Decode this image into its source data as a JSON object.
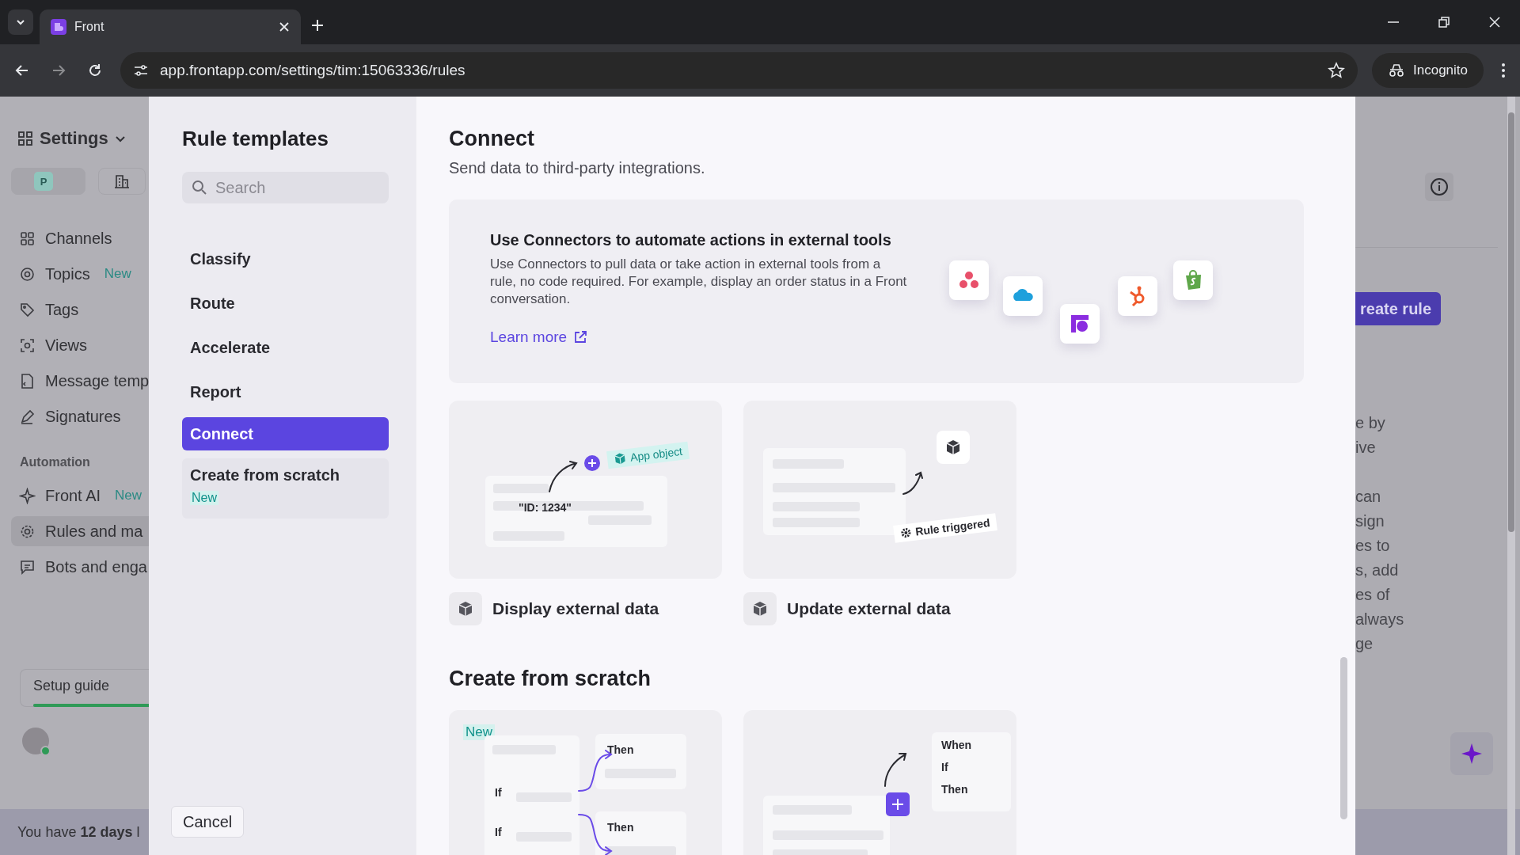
{
  "browser": {
    "tabs": [
      {
        "title": "Front",
        "selected": true
      }
    ],
    "url": "app.frontapp.com/settings/tim:15063336/rules",
    "profile": "Incognito"
  },
  "sidebar": {
    "title": "Settings",
    "scopes": [
      {
        "badge": "P",
        "selected": true
      },
      {
        "selected": false
      }
    ],
    "items": [
      {
        "label": "Channels",
        "selected": false
      },
      {
        "label": "Topics",
        "badge": "New",
        "selected": false
      },
      {
        "label": "Tags",
        "selected": false
      },
      {
        "label": "Views",
        "selected": false
      },
      {
        "label": "Message temp",
        "selected": false
      },
      {
        "label": "Signatures",
        "selected": false
      }
    ],
    "automation": {
      "heading": "Automation",
      "items": [
        {
          "label": "Front AI",
          "badge": "New",
          "selected": false
        },
        {
          "label": "Rules and ma",
          "selected": true
        },
        {
          "label": "Bots and enga",
          "selected": false
        }
      ]
    },
    "setup_guide": {
      "label": "Setup guide",
      "level": 0.8
    },
    "trial_banner": "You have **12 days** l"
  },
  "backdrop": {
    "create_button": "reate rule",
    "paragraphs": [
      [
        "e by",
        "ive"
      ],
      [
        "can",
        "sign",
        "es to",
        "s, add",
        "es of",
        "always",
        "ge"
      ]
    ]
  },
  "modal": {
    "title": "Rule templates",
    "search_placeholder": "Search",
    "categories": [
      {
        "label": "Classify",
        "selected": false
      },
      {
        "label": "Route",
        "selected": false
      },
      {
        "label": "Accelerate",
        "selected": false
      },
      {
        "label": "Report",
        "selected": false
      },
      {
        "label": "Connect",
        "selected": true
      },
      {
        "label": "Create from scratch",
        "badge": "New",
        "selected": false
      }
    ],
    "cancel": "Cancel",
    "section": {
      "title": "Connect",
      "subtitle": "Send data to third-party integrations.",
      "banner": {
        "title": "Use Connectors to automate actions in external tools",
        "body": "Use Connectors to pull data or take action in external tools from a rule, no code required. For example, display an order status in a Front conversation.",
        "link": "Learn more"
      },
      "templates": [
        {
          "kind": "display",
          "title": "Display external data",
          "labels": [
            "App object",
            "\"ID: 1234\""
          ]
        },
        {
          "kind": "update",
          "title": "Update external data",
          "labels": [
            "Rule triggered"
          ]
        }
      ]
    },
    "scratch": {
      "title": "Create from scratch",
      "templates": [
        {
          "kind": "branches",
          "badge": "New",
          "labels": [
            "Then",
            "If",
            "If",
            "Then"
          ]
        },
        {
          "kind": "steps",
          "labels": [
            "When",
            "If",
            "Then"
          ]
        }
      ]
    }
  }
}
